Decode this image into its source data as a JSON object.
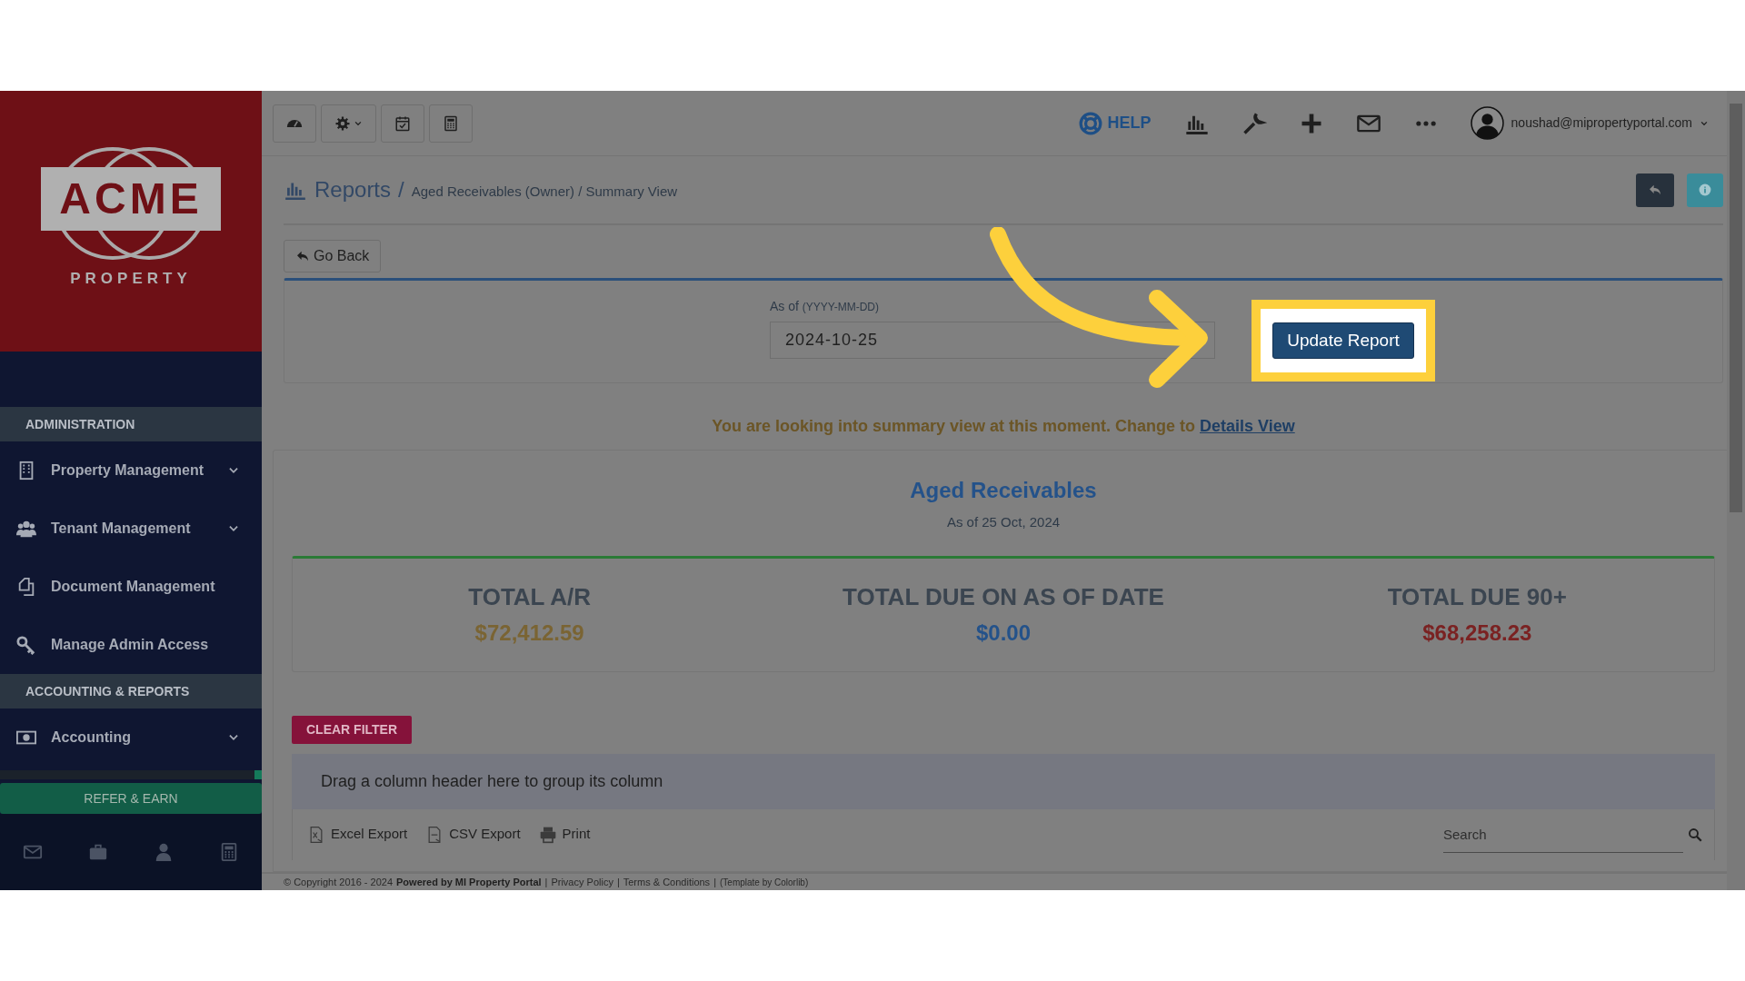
{
  "logo": {
    "word": "ACME",
    "subword": "PROPERTY"
  },
  "sidebar": {
    "sections": [
      {
        "title": "ADMINISTRATION",
        "items": [
          {
            "label": "Property Management",
            "expandable": true
          },
          {
            "label": "Tenant Management",
            "expandable": true
          },
          {
            "label": "Document Management",
            "expandable": false
          },
          {
            "label": "Manage Admin Access",
            "expandable": false
          }
        ]
      },
      {
        "title": "ACCOUNTING & REPORTS",
        "items": [
          {
            "label": "Accounting",
            "expandable": true
          }
        ]
      }
    ],
    "refer_button": "REFER & EARN"
  },
  "toolbar": {
    "help": "HELP",
    "user": "noushad@mipropertyportal.com"
  },
  "breadcrumb": {
    "title": "Reports",
    "separator": "/",
    "path": "Aged Receivables (Owner) / Summary View"
  },
  "go_back": "Go Back",
  "filter": {
    "label": "As of",
    "label_hint": "(YYYY-MM-DD)",
    "value": "2024-10-25",
    "button": "Update Report"
  },
  "message": {
    "text": "You are looking into summary view at this moment. Change to",
    "link": "Details View"
  },
  "report": {
    "title": "Aged Receivables",
    "subtitle": "As of 25 Oct, 2024",
    "totals": [
      {
        "label": "TOTAL A/R",
        "value": "$72,412.59",
        "color": "#7a6433"
      },
      {
        "label": "TOTAL DUE ON AS OF DATE",
        "value": "$0.00",
        "color": "#24528a"
      },
      {
        "label": "TOTAL DUE 90+",
        "value": "$68,258.23",
        "color": "#7a2222"
      }
    ]
  },
  "grid": {
    "clear_filter": "CLEAR FILTER",
    "group_hint": "Drag a column header here to group its column",
    "exports": [
      "Excel Export",
      "CSV Export",
      "Print"
    ],
    "search": {
      "placeholder": "Search"
    }
  },
  "footer": [
    {
      "kind": "text",
      "text": "© Copyright 2016 - 2024"
    },
    {
      "kind": "strong",
      "text": "Powered by MI Property Portal"
    },
    {
      "kind": "separator",
      "text": "|"
    },
    {
      "kind": "link",
      "text": "Privacy Policy"
    },
    {
      "kind": "separator",
      "text": "|"
    },
    {
      "kind": "link",
      "text": "Terms & Conditions"
    },
    {
      "kind": "separator",
      "text": "|"
    },
    {
      "kind": "small",
      "text": "(Template by Colorlib)"
    }
  ]
}
